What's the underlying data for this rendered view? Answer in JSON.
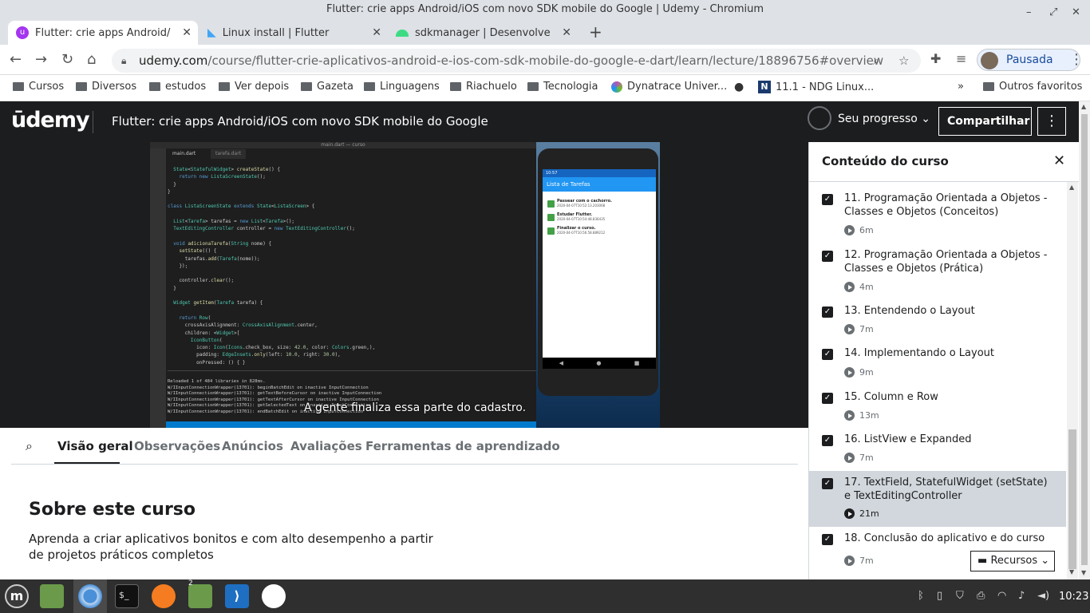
{
  "window": {
    "title": "Flutter: crie apps Android/iOS com novo SDK mobile do Google | Udemy - Chromium"
  },
  "tabs": [
    {
      "label": "Flutter: crie apps Android/iOS",
      "icon": "udemy-icon"
    },
    {
      "label": "Linux install | Flutter",
      "icon": "flutter-icon"
    },
    {
      "label": "sdkmanager  |  Desenvolvedor",
      "icon": "android-icon"
    }
  ],
  "toolbar": {
    "url_host": "udemy.com",
    "url_path": "/course/flutter-crie-aplicativos-android-e-ios-com-sdk-mobile-do-google-e-dart/learn/lecture/18896756#overview",
    "profile_label": "Pausada"
  },
  "bookmarks": [
    "Cursos",
    "Diversos",
    "estudos",
    "Ver depois",
    "Gazeta",
    "Linguagens",
    "Riachuelo",
    "Tecnologia",
    "Dynatrace Univer...",
    "11.1 - NDG Linux...",
    "Outros favoritos"
  ],
  "udemy": {
    "logo": "ūdemy",
    "course_title": "Flutter: crie apps Android/iOS com novo SDK mobile do Google",
    "progress_label": "Seu progresso",
    "share_label": "Compartilhar"
  },
  "video": {
    "caption": "A gente finaliza essa parte do cadastro.",
    "ide_title": "main.dart — curso",
    "ide_tabs": [
      "main.dart",
      "tarefa.dart"
    ],
    "phone_app_title": "Lista de Tarefas",
    "todos": [
      {
        "title": "Passear com o cachorro.",
        "date": "2020-04-07T10:52:13.203068"
      },
      {
        "title": "Estudar Flutter.",
        "date": "2020-04-07T10:54:48.836435"
      },
      {
        "title": "Finalizar o curso.",
        "date": "2020-04-07T10:56:58.889212"
      }
    ]
  },
  "content_tabs": [
    "Visão geral",
    "Observações",
    "Anúncios",
    "Avaliações",
    "Ferramentas de aprendizado"
  ],
  "about": {
    "title": "Sobre este curso",
    "description": "Aprenda a criar aplicativos bonitos e com alto desempenho a partir de projetos práticos completos"
  },
  "sidebar": {
    "title": "Conteúdo do curso",
    "lectures": [
      {
        "title": "11. Programação Orientada a Objetos - Classes e Objetos (Conceitos)",
        "duration": "6m"
      },
      {
        "title": "12. Programação Orientada a Objetos - Classes e Objetos (Prática)",
        "duration": "4m"
      },
      {
        "title": "13. Entendendo o Layout",
        "duration": "7m"
      },
      {
        "title": "14. Implementando o Layout",
        "duration": "9m"
      },
      {
        "title": "15. Column e Row",
        "duration": "13m"
      },
      {
        "title": "16. ListView e Expanded",
        "duration": "7m"
      },
      {
        "title": "17. TextField, StatefulWidget (setState) e TextEditingController",
        "duration": "21m"
      },
      {
        "title": "18. Conclusão do aplicativo e do curso",
        "duration": "7m"
      }
    ],
    "resources_label": "Recursos"
  },
  "taskbar": {
    "clock": "10:23",
    "badge": "2"
  }
}
